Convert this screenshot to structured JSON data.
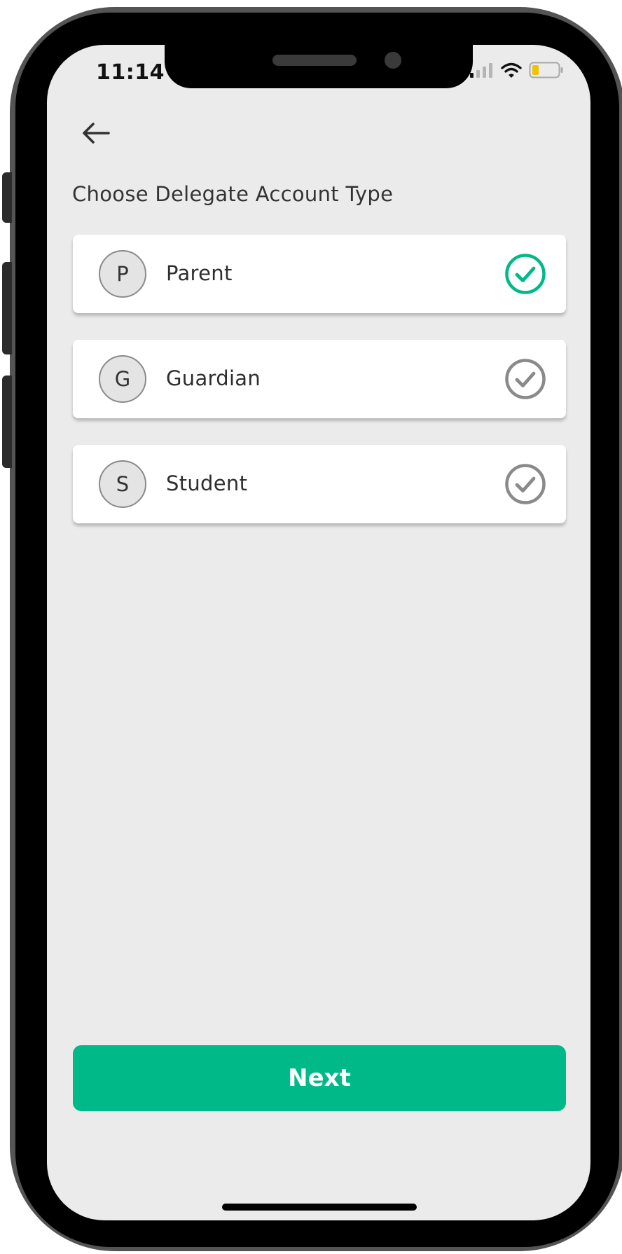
{
  "status_bar": {
    "time": "11:14",
    "icons": [
      "signal-icon",
      "wifi-icon",
      "battery-icon"
    ]
  },
  "header": {
    "back_icon": "arrow-left-icon",
    "title": "Choose Delegate Account Type"
  },
  "options": [
    {
      "initial": "P",
      "label": "Parent",
      "selected": true
    },
    {
      "initial": "G",
      "label": "Guardian",
      "selected": false
    },
    {
      "initial": "S",
      "label": "Student",
      "selected": false
    }
  ],
  "actions": {
    "next_label": "Next"
  },
  "colors": {
    "accent": "#00b988",
    "unselected_check": "#8a8a8a",
    "screen_background": "#ebebeb",
    "battery_level": "#f2c200"
  }
}
